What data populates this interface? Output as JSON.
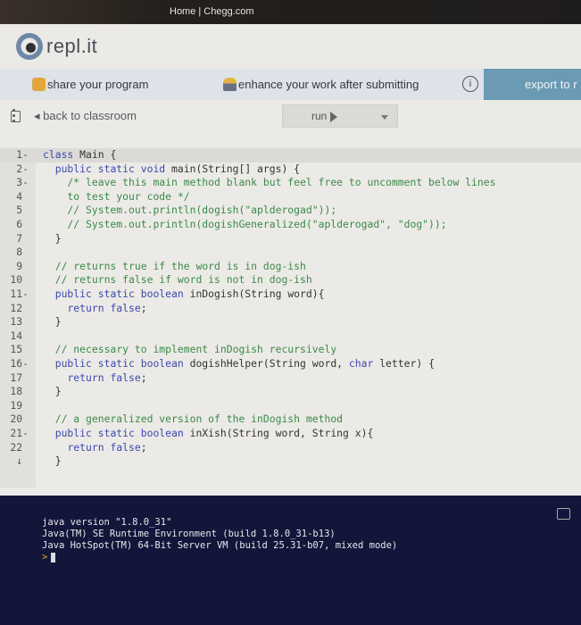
{
  "browser": {
    "tab_title": "Home | Chegg.com"
  },
  "app": {
    "logo_text": "repl.it"
  },
  "banner": {
    "share_label": "share your program",
    "enhance_label": "enhance your work after submitting",
    "info_glyph": "i",
    "export_label": "export to r"
  },
  "toolbar": {
    "back_label": "back to classroom",
    "run_label": "run"
  },
  "editor": {
    "lines": [
      {
        "n": "1",
        "fold": true,
        "parts": [
          [
            "kw",
            "class"
          ],
          [
            "tx",
            " Main {"
          ]
        ]
      },
      {
        "n": "2",
        "fold": true,
        "parts": [
          [
            "tx",
            "  "
          ],
          [
            "kw",
            "public static void"
          ],
          [
            "tx",
            " main(String[] args) {"
          ]
        ]
      },
      {
        "n": "3",
        "fold": true,
        "parts": [
          [
            "cm",
            "    /* leave this main method blank but feel free to uncomment below lines"
          ]
        ]
      },
      {
        "n": "4",
        "parts": [
          [
            "cm",
            "    to test your code */"
          ]
        ]
      },
      {
        "n": "5",
        "parts": [
          [
            "cm",
            "    // System.out.println(dogish(\"aplderogad\"));"
          ]
        ]
      },
      {
        "n": "6",
        "parts": [
          [
            "cm",
            "    // System.out.println(dogishGeneralized(\"aplderogad\", \"dog\"));"
          ]
        ]
      },
      {
        "n": "7",
        "parts": [
          [
            "tx",
            "  }"
          ]
        ]
      },
      {
        "n": "8",
        "parts": []
      },
      {
        "n": "9",
        "parts": [
          [
            "cm",
            "  // returns true if the word is in dog-ish"
          ]
        ]
      },
      {
        "n": "10",
        "parts": [
          [
            "cm",
            "  // returns false if word is not in dog-ish"
          ]
        ]
      },
      {
        "n": "11",
        "fold": true,
        "parts": [
          [
            "tx",
            "  "
          ],
          [
            "kw",
            "public static boolean"
          ],
          [
            "tx",
            " inDogish(String word){"
          ]
        ]
      },
      {
        "n": "12",
        "parts": [
          [
            "tx",
            "    "
          ],
          [
            "kw",
            "return false"
          ],
          [
            "tx",
            ";"
          ]
        ]
      },
      {
        "n": "13",
        "parts": [
          [
            "tx",
            "  }"
          ]
        ]
      },
      {
        "n": "14",
        "parts": []
      },
      {
        "n": "15",
        "parts": [
          [
            "cm",
            "  // necessary to implement inDogish recursively"
          ]
        ]
      },
      {
        "n": "16",
        "fold": true,
        "parts": [
          [
            "tx",
            "  "
          ],
          [
            "kw",
            "public static boolean"
          ],
          [
            "tx",
            " dogishHelper(String word, "
          ],
          [
            "kw",
            "char"
          ],
          [
            "tx",
            " letter) {"
          ]
        ]
      },
      {
        "n": "17",
        "parts": [
          [
            "tx",
            "    "
          ],
          [
            "kw",
            "return false"
          ],
          [
            "tx",
            ";"
          ]
        ]
      },
      {
        "n": "18",
        "parts": [
          [
            "tx",
            "  }"
          ]
        ]
      },
      {
        "n": "19",
        "parts": []
      },
      {
        "n": "20",
        "parts": [
          [
            "cm",
            "  // a generalized version of the inDogish method"
          ]
        ]
      },
      {
        "n": "21",
        "fold": true,
        "parts": [
          [
            "tx",
            "  "
          ],
          [
            "kw",
            "public static boolean"
          ],
          [
            "tx",
            " inXish(String word, String x){"
          ]
        ]
      },
      {
        "n": "22",
        "parts": [
          [
            "tx",
            "    "
          ],
          [
            "kw",
            "return false"
          ],
          [
            "tx",
            ";"
          ]
        ]
      },
      {
        "n": "↓",
        "parts": [
          [
            "tx",
            "  }"
          ]
        ]
      }
    ]
  },
  "console": {
    "lines": [
      "java version \"1.8.0_31\"",
      "Java(TM) SE Runtime Environment (build 1.8.0_31-b13)",
      "Java HotSpot(TM) 64-Bit Server VM (build 25.31-b07, mixed mode)"
    ],
    "prompt": ">"
  }
}
